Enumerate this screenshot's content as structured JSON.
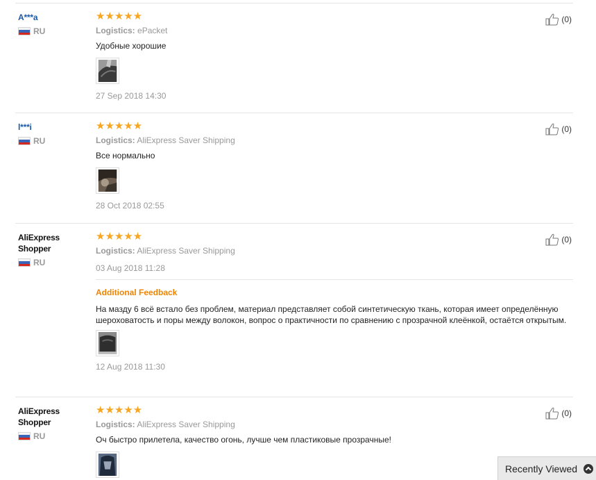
{
  "reviews": [
    {
      "user": "A***a",
      "country": "RU",
      "rating": "★★★★★",
      "logistics_label": "Logistics:",
      "logistics_value": "ePacket",
      "text": "Удобные хорошие",
      "date": "27 Sep 2018 14:30",
      "helpful_count": "(0)"
    },
    {
      "user": "l***i",
      "country": "RU",
      "rating": "★★★★★",
      "logistics_label": "Logistics:",
      "logistics_value": "AliExpress Saver Shipping",
      "text": "Все нормально",
      "date": "28 Oct 2018 02:55",
      "helpful_count": "(0)"
    },
    {
      "user_line1": "AliExpress",
      "user_line2": "Shopper",
      "country": "RU",
      "rating": "★★★★★",
      "logistics_label": "Logistics:",
      "logistics_value": "AliExpress Saver Shipping",
      "date": "03 Aug 2018 11:28",
      "additional_title": "Additional Feedback",
      "additional_text": "На мазду 6 всё встало без проблем, материал представляет собой синтетическую ткань, которая имеет определённую шероховатость и поры между волокон, вопрос о практичности по сравнению с прозрачной клеёнкой, остаётся открытым.",
      "additional_date": "12 Aug 2018 11:30",
      "helpful_count": "(0)"
    },
    {
      "user_line1": "AliExpress",
      "user_line2": "Shopper",
      "country": "RU",
      "rating": "★★★★★",
      "logistics_label": "Logistics:",
      "logistics_value": "AliExpress Saver Shipping",
      "text": "Оч быстро прилетела, качество огонь, лучше чем пластиковые прозрачные!",
      "helpful_count": "(0)"
    }
  ],
  "recently_viewed": {
    "label": "Recently Viewed",
    "icon": "chevron-up-icon"
  },
  "colors": {
    "star": "#f6a623",
    "user_link": "#1a5aa8",
    "additional_title": "#f08300"
  }
}
